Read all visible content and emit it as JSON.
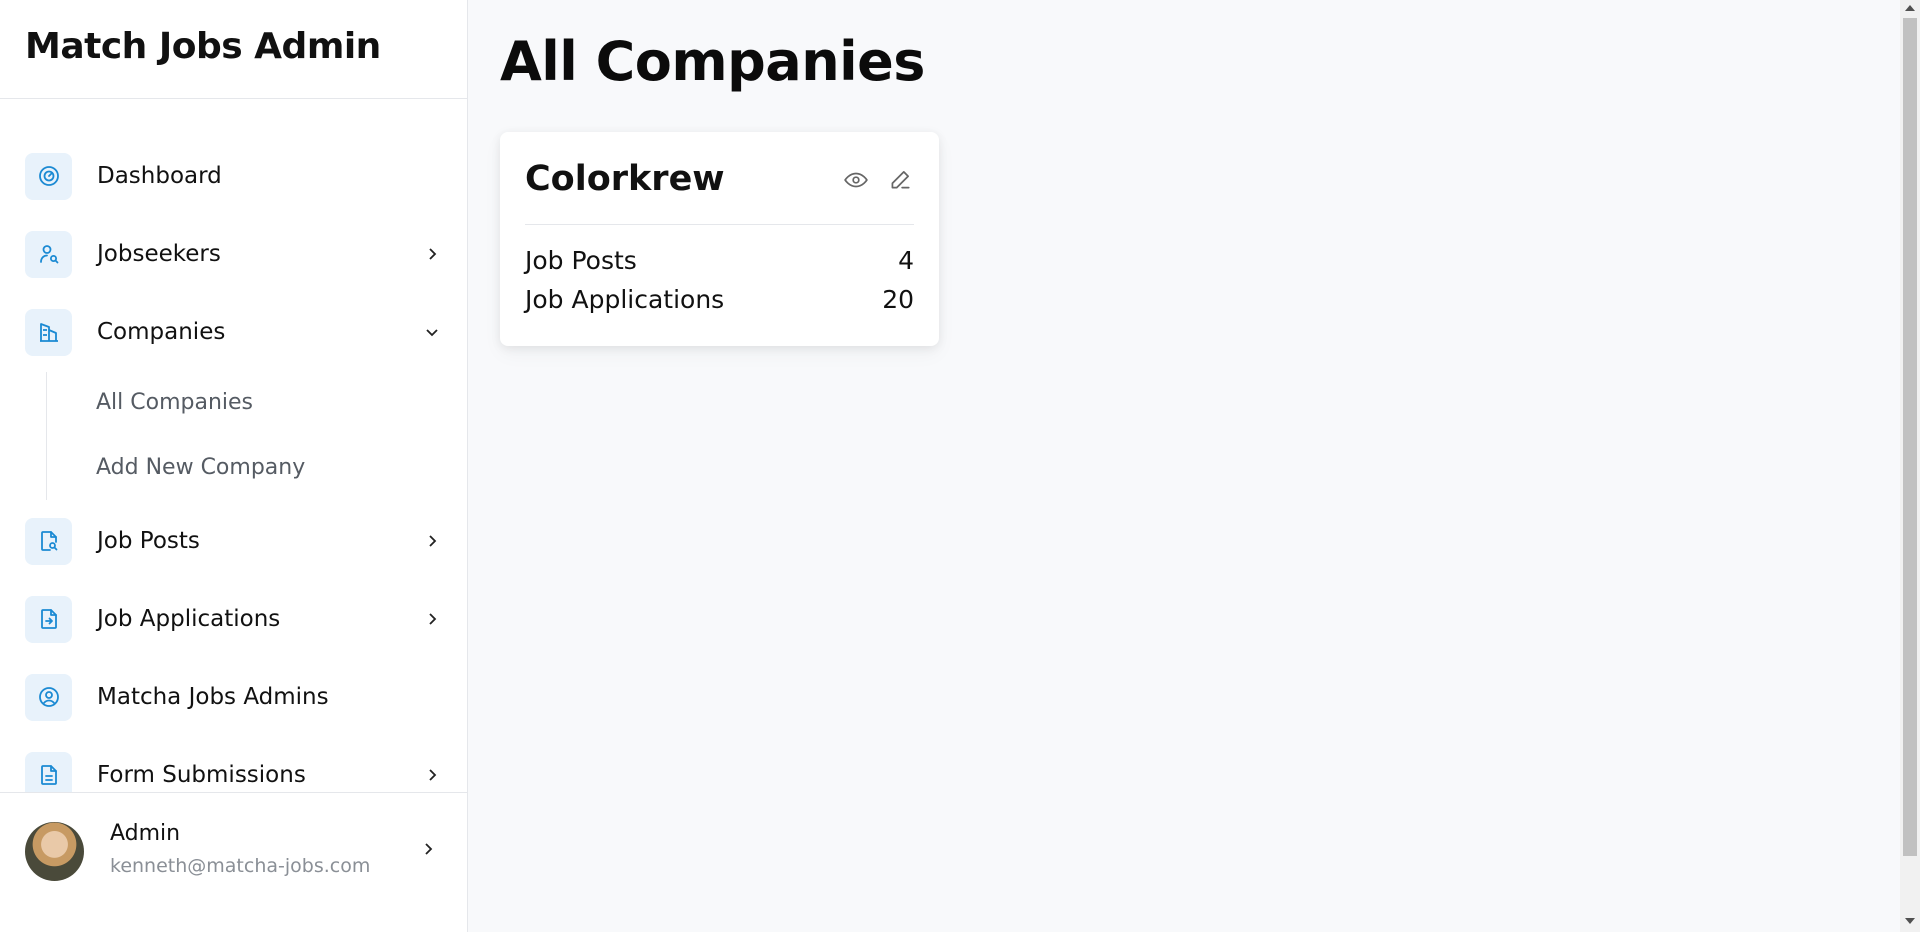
{
  "sidebar": {
    "brand": "Match Jobs Admin",
    "items": [
      {
        "label": "Dashboard",
        "icon": "dashboard-gauge-icon",
        "has_chevron": false
      },
      {
        "label": "Jobseekers",
        "icon": "user-search-icon",
        "has_chevron": true
      },
      {
        "label": "Companies",
        "icon": "building-icon",
        "has_chevron": true,
        "expanded": true
      },
      {
        "label": "Job Posts",
        "icon": "document-search-icon",
        "has_chevron": true
      },
      {
        "label": "Job Applications",
        "icon": "document-arrow-icon",
        "has_chevron": true
      },
      {
        "label": "Matcha Jobs Admins",
        "icon": "user-circle-icon",
        "has_chevron": false
      },
      {
        "label": "Form Submissions",
        "icon": "document-text-icon",
        "has_chevron": true
      }
    ],
    "companies_submenu": [
      "All Companies",
      "Add New Company"
    ],
    "user": {
      "name": "Admin",
      "email": "kenneth@matcha-jobs.com"
    }
  },
  "main": {
    "title": "All Companies",
    "companies": [
      {
        "name": "Colorkrew",
        "stats": [
          {
            "label": "Job Posts",
            "value": "4"
          },
          {
            "label": "Job Applications",
            "value": "20"
          }
        ]
      }
    ]
  },
  "colors": {
    "accent": "#1b8ad3",
    "icon_bg": "#e8f2fb",
    "page_bg": "#f8f9fb"
  }
}
